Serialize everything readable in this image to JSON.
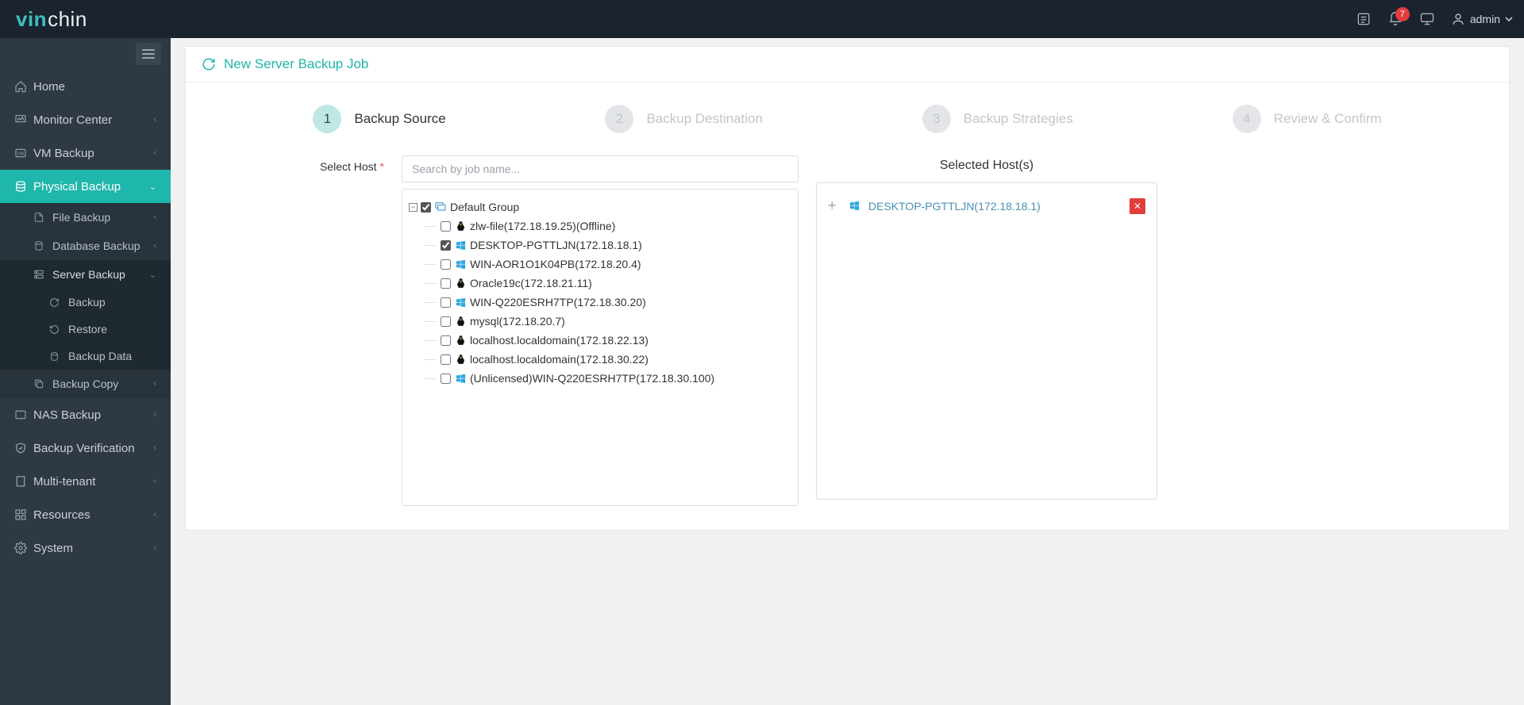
{
  "brand": {
    "part1": "vin",
    "part2": "chin"
  },
  "header": {
    "notif_count": "7",
    "user": "admin"
  },
  "sidebar": {
    "items": {
      "home": "Home",
      "monitor": "Monitor Center",
      "vm": "VM Backup",
      "physical": "Physical Backup",
      "nas": "NAS Backup",
      "verify": "Backup Verification",
      "multi": "Multi-tenant",
      "res": "Resources",
      "sys": "System"
    },
    "physical_sub": {
      "file": "File Backup",
      "db": "Database Backup",
      "server": "Server Backup",
      "copy": "Backup Copy"
    },
    "server_sub": {
      "backup": "Backup",
      "restore": "Restore",
      "data": "Backup Data"
    }
  },
  "page": {
    "title": "New Server Backup Job",
    "steps": [
      {
        "num": "1",
        "label": "Backup Source",
        "active": true
      },
      {
        "num": "2",
        "label": "Backup Destination",
        "active": false
      },
      {
        "num": "3",
        "label": "Backup Strategies",
        "active": false
      },
      {
        "num": "4",
        "label": "Review & Confirm",
        "active": false
      }
    ],
    "select_host_label": "Select Host",
    "search_placeholder": "Search by job name..."
  },
  "tree": {
    "group": "Default Group",
    "hosts": [
      {
        "os": "linux",
        "checked": false,
        "name": "zlw-file(172.18.19.25)(Offline)"
      },
      {
        "os": "windows",
        "checked": true,
        "name": "DESKTOP-PGTTLJN(172.18.18.1)"
      },
      {
        "os": "windows",
        "checked": false,
        "name": "WIN-AOR1O1K04PB(172.18.20.4)"
      },
      {
        "os": "linux",
        "checked": false,
        "name": "Oracle19c(172.18.21.11)"
      },
      {
        "os": "windows",
        "checked": false,
        "name": "WIN-Q220ESRH7TP(172.18.30.20)"
      },
      {
        "os": "linux",
        "checked": false,
        "name": "mysql(172.18.20.7)"
      },
      {
        "os": "linux",
        "checked": false,
        "name": "localhost.localdomain(172.18.22.13)"
      },
      {
        "os": "linux",
        "checked": false,
        "name": "localhost.localdomain(172.18.30.22)"
      },
      {
        "os": "windows",
        "checked": false,
        "name": "(Unlicensed)WIN-Q220ESRH7TP(172.18.30.100)"
      }
    ]
  },
  "selected": {
    "title": "Selected Host(s)",
    "items": [
      {
        "os": "windows",
        "label": "DESKTOP-PGTTLJN(172.18.18.1)"
      }
    ]
  }
}
